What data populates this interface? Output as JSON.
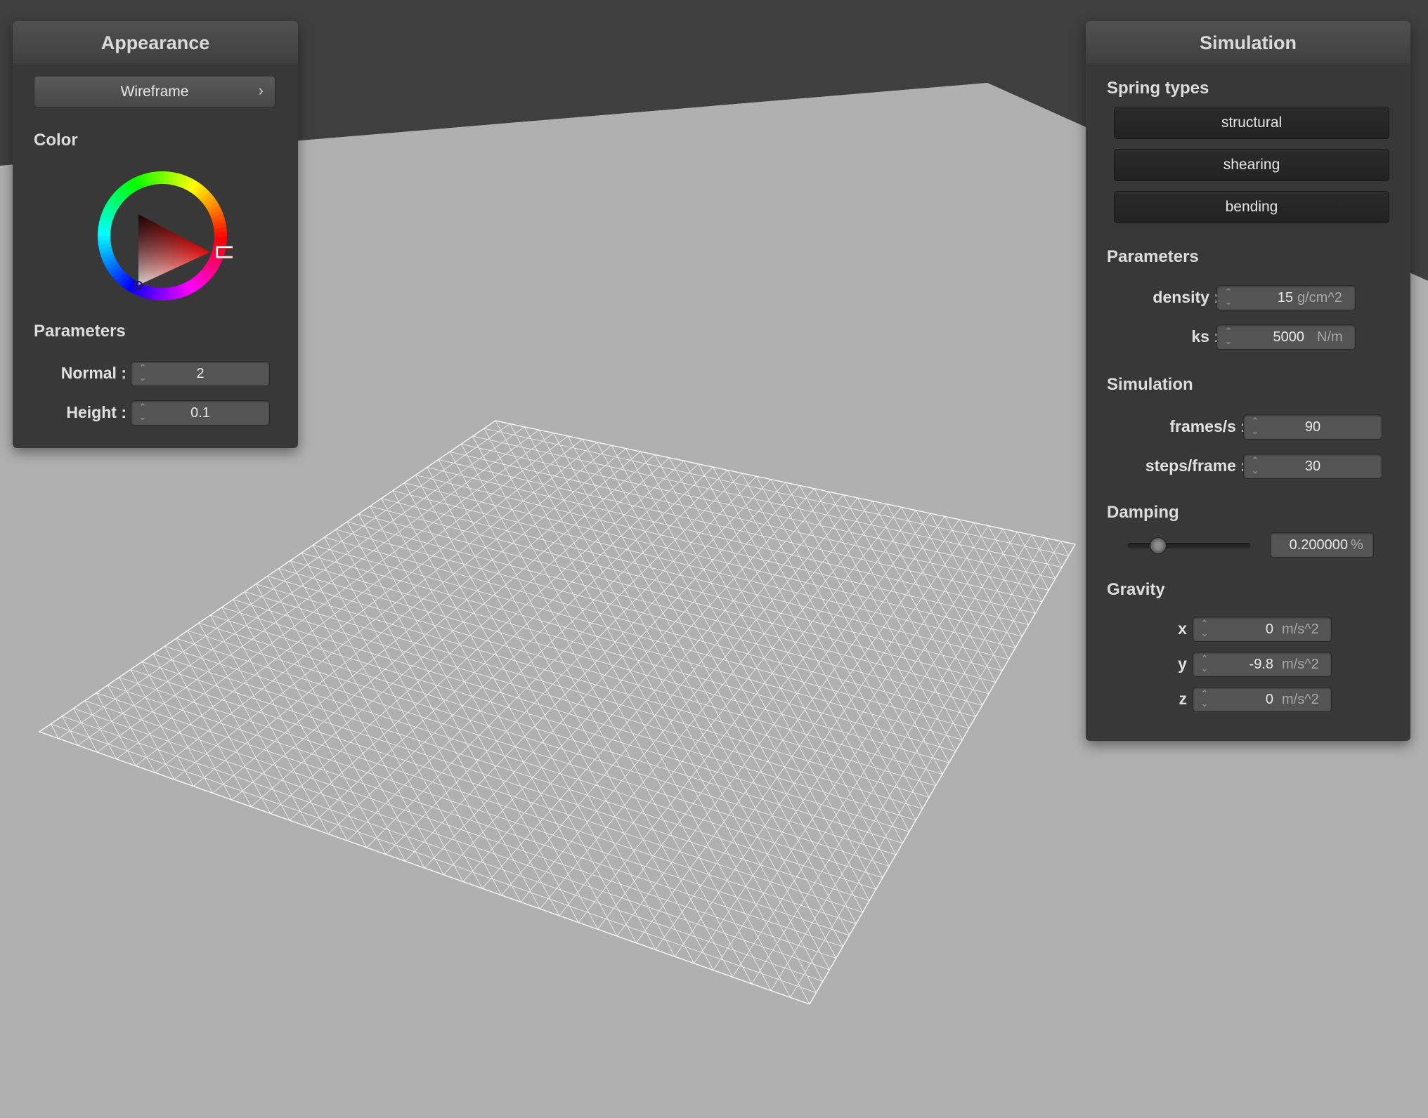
{
  "appearance": {
    "title": "Appearance",
    "shader_button": "Wireframe",
    "chevron_icon": "chevron-right-icon",
    "color_label": "Color",
    "color_value": "#ff0000",
    "parameters_label": "Parameters",
    "normal_label": "Normal :",
    "normal_value": "2",
    "height_label": "Height :",
    "height_value": "0.1"
  },
  "simulation": {
    "title": "Simulation",
    "spring_types_label": "Spring types",
    "structural": "structural",
    "shearing": "shearing",
    "bending": "bending",
    "parameters_label": "Parameters",
    "density_label": "density :",
    "density_value": "15",
    "density_unit": "g/cm^2",
    "ks_label": "ks :",
    "ks_value": "5000",
    "ks_unit": "N/m",
    "sim_label": "Simulation",
    "fps_label": "frames/s :",
    "fps_value": "90",
    "steps_label": "steps/frame :",
    "steps_value": "30",
    "damping_label": "Damping",
    "damping_value": "0.200000",
    "damping_unit": "%",
    "damping_fraction": 0.2,
    "gravity_label": "Gravity",
    "x_label": "x :",
    "x_value": "0",
    "y_label": "y :",
    "y_value": "-9.8",
    "z_label": "z :",
    "z_value": "0",
    "gravity_unit": "m/s^2"
  },
  "colors": {
    "background": "#b0b0b0",
    "wall": "#3f3f3f",
    "panel": "#383838",
    "cloth": "#ffffff"
  }
}
